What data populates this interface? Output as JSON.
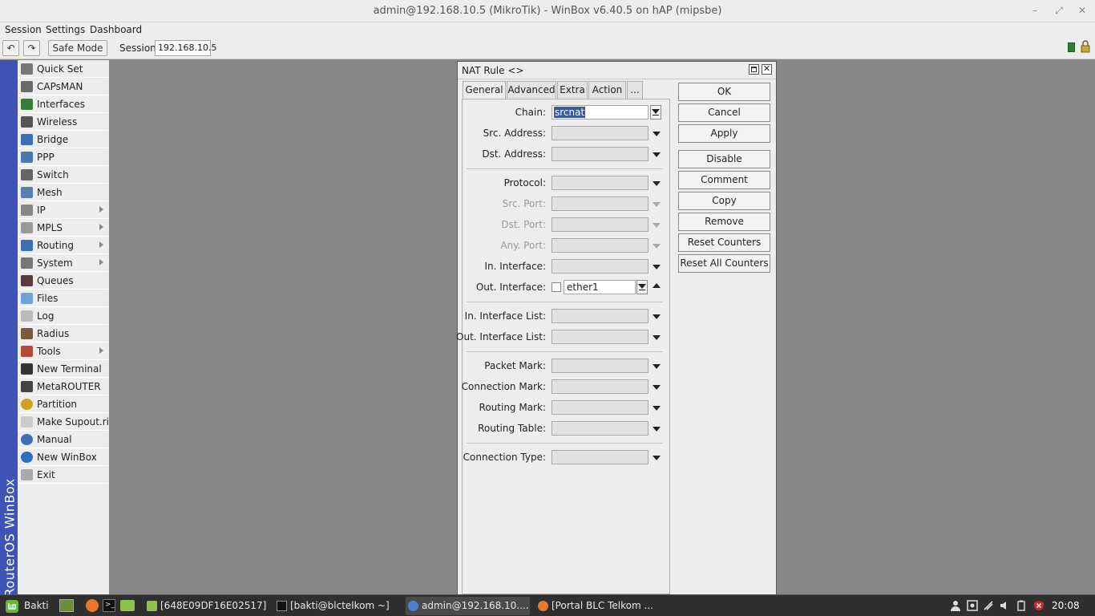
{
  "window": {
    "title": "admin@192.168.10.5 (MikroTik) - WinBox v6.40.5 on hAP (mipsbe)"
  },
  "menu": {
    "session": "Session",
    "settings": "Settings",
    "dashboard": "Dashboard"
  },
  "toolbar": {
    "undo": "↶",
    "redo": "↷",
    "safe_mode": "Safe Mode",
    "session_label": "Session:",
    "session_value": "192.168.10.5"
  },
  "brand": {
    "vertical_text": "RouterOS WinBox"
  },
  "sidebar": {
    "items": [
      {
        "label": "Quick Set",
        "icon": "quickset-icon",
        "submenu": false
      },
      {
        "label": "CAPsMAN",
        "icon": "capsman-icon",
        "submenu": false
      },
      {
        "label": "Interfaces",
        "icon": "interfaces-icon",
        "submenu": false
      },
      {
        "label": "Wireless",
        "icon": "wireless-icon",
        "submenu": false
      },
      {
        "label": "Bridge",
        "icon": "bridge-icon",
        "submenu": false
      },
      {
        "label": "PPP",
        "icon": "ppp-icon",
        "submenu": false
      },
      {
        "label": "Switch",
        "icon": "switch-icon",
        "submenu": false
      },
      {
        "label": "Mesh",
        "icon": "mesh-icon",
        "submenu": false
      },
      {
        "label": "IP",
        "icon": "ip-icon",
        "submenu": true
      },
      {
        "label": "MPLS",
        "icon": "mpls-icon",
        "submenu": true
      },
      {
        "label": "Routing",
        "icon": "routing-icon",
        "submenu": true
      },
      {
        "label": "System",
        "icon": "system-icon",
        "submenu": true
      },
      {
        "label": "Queues",
        "icon": "queues-icon",
        "submenu": false
      },
      {
        "label": "Files",
        "icon": "files-icon",
        "submenu": false
      },
      {
        "label": "Log",
        "icon": "log-icon",
        "submenu": false
      },
      {
        "label": "Radius",
        "icon": "radius-icon",
        "submenu": false
      },
      {
        "label": "Tools",
        "icon": "tools-icon",
        "submenu": true
      },
      {
        "label": "New Terminal",
        "icon": "terminal-icon",
        "submenu": false
      },
      {
        "label": "MetaROUTER",
        "icon": "metarouter-icon",
        "submenu": false
      },
      {
        "label": "Partition",
        "icon": "partition-icon",
        "submenu": false
      },
      {
        "label": "Make Supout.rif",
        "icon": "supout-icon",
        "submenu": false
      },
      {
        "label": "Manual",
        "icon": "manual-icon",
        "submenu": false
      },
      {
        "label": "New WinBox",
        "icon": "winbox-icon",
        "submenu": false
      },
      {
        "label": "Exit",
        "icon": "exit-icon",
        "submenu": false
      }
    ]
  },
  "dialog": {
    "title": "NAT Rule <>",
    "tabs": [
      "General",
      "Advanced",
      "Extra",
      "Action",
      "..."
    ],
    "fields": {
      "chain": {
        "label": "Chain:",
        "value": "srcnat"
      },
      "src_address": {
        "label": "Src. Address:"
      },
      "dst_address": {
        "label": "Dst. Address:"
      },
      "protocol": {
        "label": "Protocol:"
      },
      "src_port": {
        "label": "Src. Port:"
      },
      "dst_port": {
        "label": "Dst. Port:"
      },
      "any_port": {
        "label": "Any. Port:"
      },
      "in_interface": {
        "label": "In. Interface:"
      },
      "out_interface": {
        "label": "Out. Interface:",
        "value": "ether1"
      },
      "in_interface_list": {
        "label": "In. Interface List:"
      },
      "out_interface_list": {
        "label": "Out. Interface List:"
      },
      "packet_mark": {
        "label": "Packet Mark:"
      },
      "connection_mark": {
        "label": "Connection Mark:"
      },
      "routing_mark": {
        "label": "Routing Mark:"
      },
      "routing_table": {
        "label": "Routing Table:"
      },
      "connection_type": {
        "label": "Connection Type:"
      }
    },
    "buttons": {
      "ok": "OK",
      "cancel": "Cancel",
      "apply": "Apply",
      "disable": "Disable",
      "comment": "Comment",
      "copy": "Copy",
      "remove": "Remove",
      "reset_counters": "Reset Counters",
      "reset_all_counters": "Reset All Counters"
    }
  },
  "taskbar": {
    "start_label": "Bakti",
    "windows": [
      {
        "label": "[648E09DF16E02517]",
        "icon": "folder-icon"
      },
      {
        "label": "[bakti@blctelkom ~]",
        "icon": "terminal-icon"
      },
      {
        "label": "admin@192.168.10....",
        "icon": "winbox-icon"
      },
      {
        "label": "[Portal BLC Telkom ...",
        "icon": "firefox-icon"
      }
    ],
    "clock": "20:08"
  },
  "colors": {
    "brand_strip": "#3f52b5",
    "selection": "#3d5a99",
    "status_green": "#2e7d32"
  }
}
